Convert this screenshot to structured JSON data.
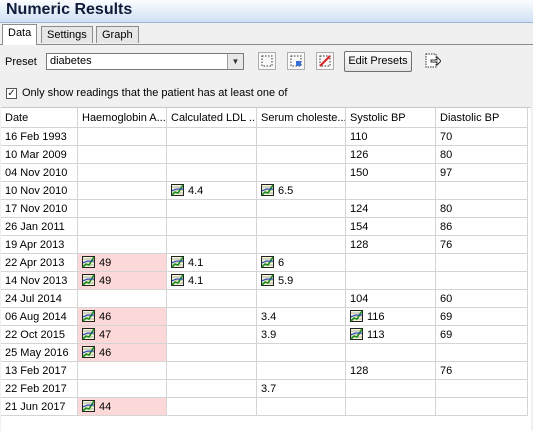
{
  "window": {
    "title": "Numeric Results"
  },
  "tabs": [
    {
      "label": "Data",
      "active": true
    },
    {
      "label": "Settings",
      "active": false
    },
    {
      "label": "Graph",
      "active": false
    }
  ],
  "preset": {
    "label": "Preset",
    "value": "diabetes",
    "edit_label": "Edit Presets"
  },
  "filter": {
    "label": "Only show readings that the patient has at least one of",
    "checked": true
  },
  "columns": [
    "Date",
    "Haemoglobin A...",
    "Calculated LDL ...",
    "Serum choleste...",
    "Systolic BP",
    "Diastolic BP"
  ],
  "highlight_color": "#fcd9d8",
  "rows": [
    {
      "date": "16 Feb 1993",
      "cells": [
        null,
        null,
        null,
        {
          "v": "110"
        },
        {
          "v": "70"
        }
      ]
    },
    {
      "date": "10 Mar 2009",
      "cells": [
        null,
        null,
        null,
        {
          "v": "126"
        },
        {
          "v": "80"
        }
      ]
    },
    {
      "date": "04 Nov 2010",
      "cells": [
        null,
        null,
        null,
        {
          "v": "150"
        },
        {
          "v": "97"
        }
      ]
    },
    {
      "date": "10 Nov 2010",
      "cells": [
        null,
        {
          "v": "4.4",
          "icon": true
        },
        {
          "v": "6.5",
          "icon": true
        },
        null,
        null
      ]
    },
    {
      "date": "17 Nov 2010",
      "cells": [
        null,
        null,
        null,
        {
          "v": "124"
        },
        {
          "v": "80"
        }
      ]
    },
    {
      "date": "26 Jan 2011",
      "cells": [
        null,
        null,
        null,
        {
          "v": "154"
        },
        {
          "v": "86"
        }
      ]
    },
    {
      "date": "19 Apr 2013",
      "cells": [
        null,
        null,
        null,
        {
          "v": "128"
        },
        {
          "v": "76"
        }
      ]
    },
    {
      "date": "22 Apr 2013",
      "cells": [
        {
          "v": "49",
          "icon": true,
          "hl": true
        },
        {
          "v": "4.1",
          "icon": true
        },
        {
          "v": "6",
          "icon": true
        },
        null,
        null
      ]
    },
    {
      "date": "14 Nov 2013",
      "cells": [
        {
          "v": "49",
          "icon": true,
          "hl": true
        },
        {
          "v": "4.1",
          "icon": true
        },
        {
          "v": "5.9",
          "icon": true
        },
        null,
        null
      ]
    },
    {
      "date": "24 Jul 2014",
      "cells": [
        null,
        null,
        null,
        {
          "v": "104"
        },
        {
          "v": "60"
        }
      ]
    },
    {
      "date": "06 Aug 2014",
      "cells": [
        {
          "v": "46",
          "icon": true,
          "hl": true
        },
        null,
        {
          "v": "3.4"
        },
        {
          "v": "116",
          "icon": true
        },
        {
          "v": "69"
        }
      ]
    },
    {
      "date": "22 Oct 2015",
      "cells": [
        {
          "v": "47",
          "icon": true,
          "hl": true
        },
        null,
        {
          "v": "3.9"
        },
        {
          "v": "113",
          "icon": true
        },
        {
          "v": "69"
        }
      ]
    },
    {
      "date": "25 May 2016",
      "cells": [
        {
          "v": "46",
          "icon": true,
          "hl": true
        },
        null,
        null,
        null,
        null
      ]
    },
    {
      "date": "13 Feb 2017",
      "cells": [
        null,
        null,
        null,
        {
          "v": "128"
        },
        {
          "v": "76"
        }
      ]
    },
    {
      "date": "22 Feb 2017",
      "cells": [
        null,
        null,
        {
          "v": "3.7"
        },
        null,
        null
      ]
    },
    {
      "date": "21 Jun 2017",
      "cells": [
        {
          "v": "44",
          "icon": true,
          "hl": true
        },
        null,
        null,
        null,
        null
      ]
    }
  ]
}
